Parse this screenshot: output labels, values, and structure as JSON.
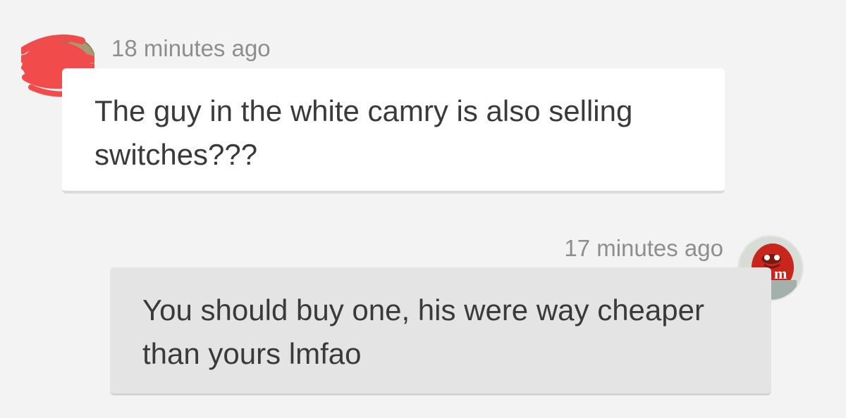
{
  "messages": [
    {
      "direction": "incoming",
      "timestamp": "18 minutes ago",
      "text": "The guy in the white camry is also selling switches???",
      "avatar": "redacted-avatar-icon"
    },
    {
      "direction": "outgoing",
      "timestamp": "17 minutes ago",
      "text": "You should buy one, his were way cheaper than yours lmfao",
      "avatar": "red-mm-character-avatar-icon",
      "avatar_letter": "m"
    }
  ],
  "colors": {
    "background": "#f3f3f3",
    "incoming_bubble": "#ffffff",
    "outgoing_bubble": "#e4e4e4",
    "timestamp": "#8e8e8e",
    "text": "#3a3a3a",
    "redaction": "#f24b4b"
  }
}
